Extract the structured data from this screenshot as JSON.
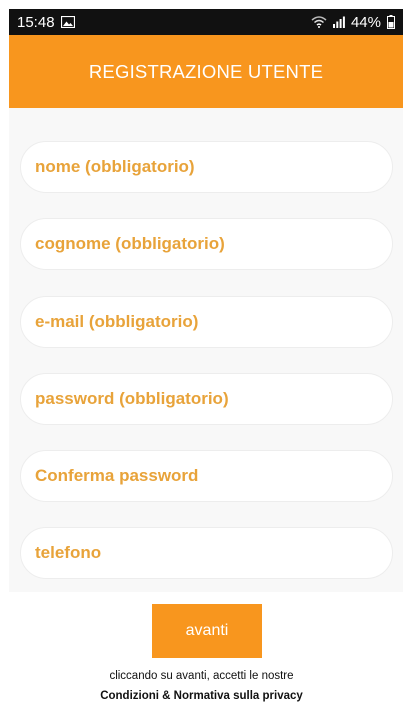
{
  "status_bar": {
    "time": "15:48",
    "battery": "44%",
    "icons": [
      "image-icon",
      "wifi-icon",
      "signal-icon",
      "battery-icon"
    ]
  },
  "header": {
    "title": "REGISTRAZIONE UTENTE",
    "color": "#f8961e"
  },
  "form": {
    "fields": [
      {
        "placeholder": "nome (obbligatorio)",
        "value": ""
      },
      {
        "placeholder": "cognome (obbligatorio)",
        "value": ""
      },
      {
        "placeholder": "e-mail (obbligatorio)",
        "value": ""
      },
      {
        "placeholder": "password (obbligatorio)",
        "value": ""
      },
      {
        "placeholder": "Conferma password",
        "value": ""
      },
      {
        "placeholder": "telefono",
        "value": ""
      }
    ],
    "field_text_color": "#e8a33a"
  },
  "actions": {
    "next_label": "avanti"
  },
  "footer": {
    "consent_text": "cliccando su avanti, accetti le nostre",
    "privacy_link": "Condizioni & Normativa sulla privacy"
  }
}
